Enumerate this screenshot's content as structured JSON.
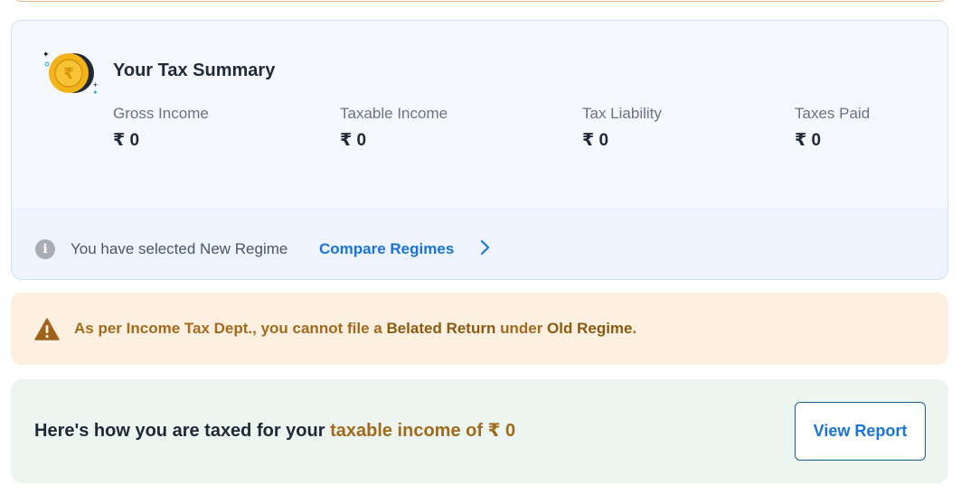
{
  "summary": {
    "title": "Your Tax Summary",
    "stats": [
      {
        "label": "Gross Income",
        "value": "₹ 0"
      },
      {
        "label": "Taxable Income",
        "value": "₹ 0"
      },
      {
        "label": "Tax Liability",
        "value": "₹ 0"
      },
      {
        "label": "Taxes Paid",
        "value": "₹ 0"
      }
    ],
    "regime_text": "You have selected New Regime",
    "compare_link": "Compare Regimes",
    "icons": {
      "coin": "rupee-coin-icon",
      "info": "info-icon",
      "chevron": "chevron-right-icon"
    }
  },
  "warning": {
    "prefix": "As per Income Tax Dept., you cannot file a ",
    "bold1": "Belated Return",
    "middle": " under ",
    "bold2": "Old Regime",
    "suffix": ".",
    "icon": "warning-icon"
  },
  "tax": {
    "text": "Here's how you are taxed for your ",
    "highlight": "taxable income of ₹ 0",
    "button": "View Report"
  },
  "colors": {
    "accent_blue": "#1a73d9",
    "warning_text": "#a16a1c",
    "warning_bg": "#fdf0e1",
    "tax_bg": "#edf5f0",
    "summary_bg": "#f5f9fe"
  }
}
